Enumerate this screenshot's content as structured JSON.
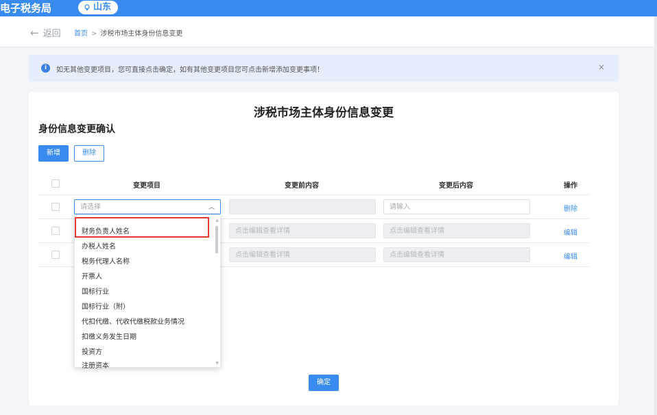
{
  "header": {
    "app_title": "电子税务局",
    "region": "山东"
  },
  "breadcrumb": {
    "back": "返回",
    "home": "首页",
    "separator": ">",
    "current": "涉税市场主体身份信息变更"
  },
  "alert": {
    "text": "如无其他变更项目，您可直接点击确定，如有其他变更项目您可点击新增添加变更事项！",
    "close": "×"
  },
  "form": {
    "title": "涉税市场主体身份信息变更",
    "section_title": "身份信息变更确认",
    "add_button": "新增",
    "delete_button": "删除",
    "columns": [
      "变更项目",
      "变更前内容",
      "变更后内容",
      "操作"
    ],
    "rows": [
      {
        "item_placeholder": "请选择",
        "before": "",
        "after_placeholder": "请输入",
        "action": "删除"
      },
      {
        "item": "",
        "before": "点击编辑查看详情",
        "after": "点击编辑查看详情",
        "action": "编辑"
      },
      {
        "item": "",
        "before": "点击编辑查看详情",
        "after": "点击编辑查看详情",
        "action": "编辑"
      }
    ],
    "confirm_button": "确定"
  },
  "dropdown": {
    "options": [
      "财务负责人姓名",
      "办税人姓名",
      "税务代理人名称",
      "开票人",
      "国标行业",
      "国标行业（附）",
      "代扣代缴、代收代缴税款业务情况",
      "扣缴义务发生日期",
      "投资方",
      "注册资本"
    ],
    "highlighted_index": 0
  },
  "colors": {
    "primary": "#3a8bf0",
    "highlight_border": "#e53935"
  }
}
